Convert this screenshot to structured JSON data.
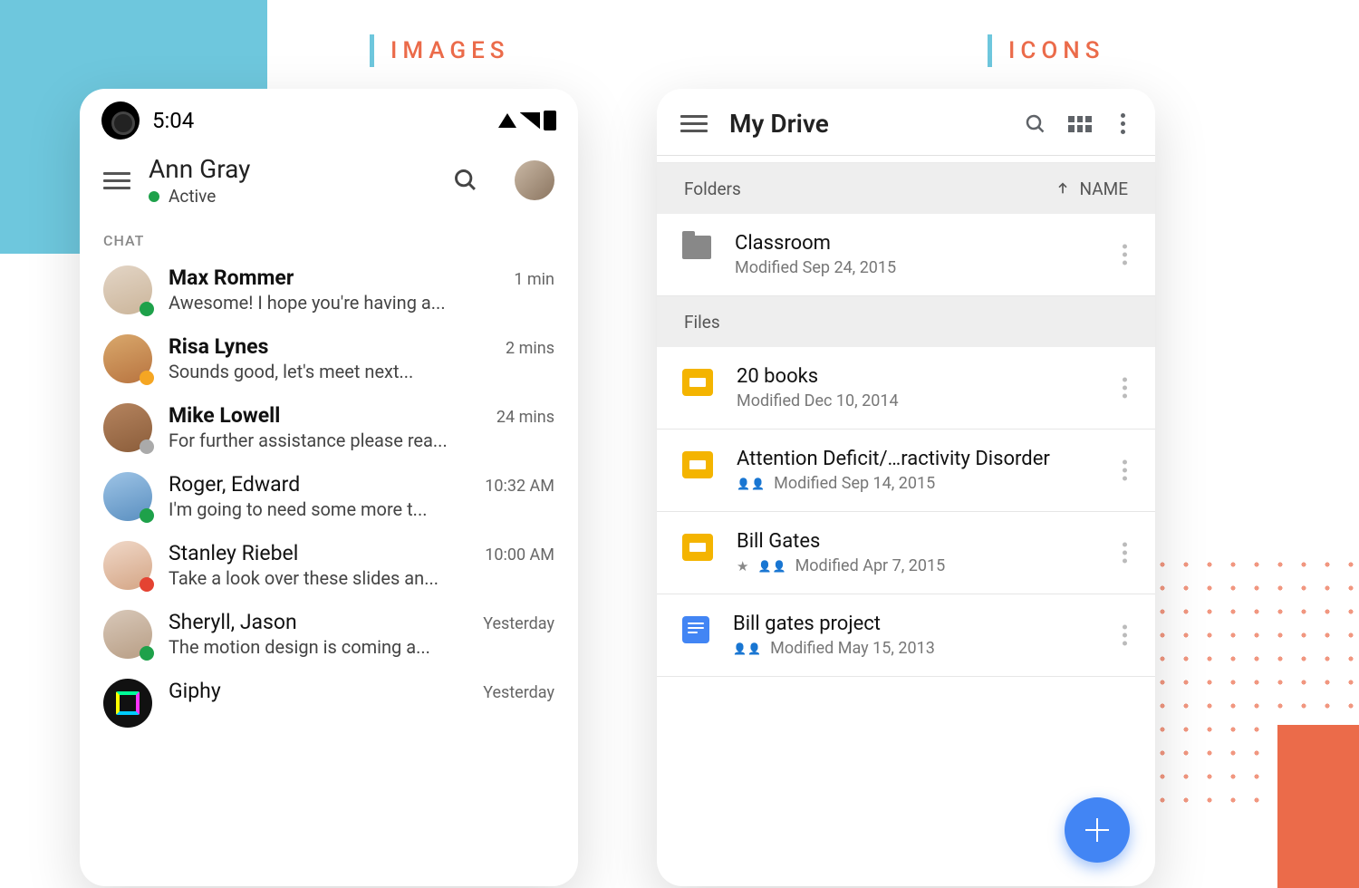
{
  "headings": {
    "images": "IMAGES",
    "icons": "ICONS"
  },
  "chat": {
    "statusbar_time": "5:04",
    "header": {
      "name": "Ann Gray",
      "status": "Active"
    },
    "section_label": "CHAT",
    "items": [
      {
        "name": "Max Rommer",
        "preview": "Awesome! I hope you're having a...",
        "time": "1 min",
        "bold": true,
        "presence": "green"
      },
      {
        "name": "Risa Lynes",
        "preview": "Sounds good, let's meet next...",
        "time": "2 mins",
        "bold": true,
        "presence": "video"
      },
      {
        "name": "Mike Lowell",
        "preview": "For further assistance please rea...",
        "time": "24 mins",
        "bold": true,
        "presence": "gray"
      },
      {
        "name": "Roger, Edward",
        "preview": "I'm going to need some more t...",
        "time": "10:32 AM",
        "bold": false,
        "presence": "green"
      },
      {
        "name": "Stanley Riebel",
        "preview": "Take a look over these slides an...",
        "time": "10:00 AM",
        "bold": false,
        "presence": "red"
      },
      {
        "name": "Sheryll, Jason",
        "preview": "The motion design is coming  a...",
        "time": "Yesterday",
        "bold": false,
        "presence": "green"
      },
      {
        "name": "Giphy",
        "preview": "",
        "time": "Yesterday",
        "bold": false,
        "presence": "none"
      }
    ]
  },
  "drive": {
    "header": {
      "title": "My Drive"
    },
    "sections": {
      "folders_label": "Folders",
      "sort_label": "NAME",
      "files_label": "Files"
    },
    "folders": [
      {
        "name": "Classroom",
        "meta": "Modified Sep 24, 2015",
        "icon": "folder"
      }
    ],
    "files": [
      {
        "name": "20 books",
        "meta": "Modified Dec 10, 2014",
        "icon": "slides",
        "shared": false,
        "starred": false
      },
      {
        "name": "Attention Deficit/…ractivity Disorder",
        "meta": "Modified Sep 14, 2015",
        "icon": "slides",
        "shared": true,
        "starred": false
      },
      {
        "name": "Bill Gates",
        "meta": "Modified Apr 7, 2015",
        "icon": "slides",
        "shared": true,
        "starred": true
      },
      {
        "name": "Bill gates project",
        "meta": "Modified May 15, 2013",
        "icon": "docs",
        "shared": true,
        "starred": false
      }
    ]
  }
}
